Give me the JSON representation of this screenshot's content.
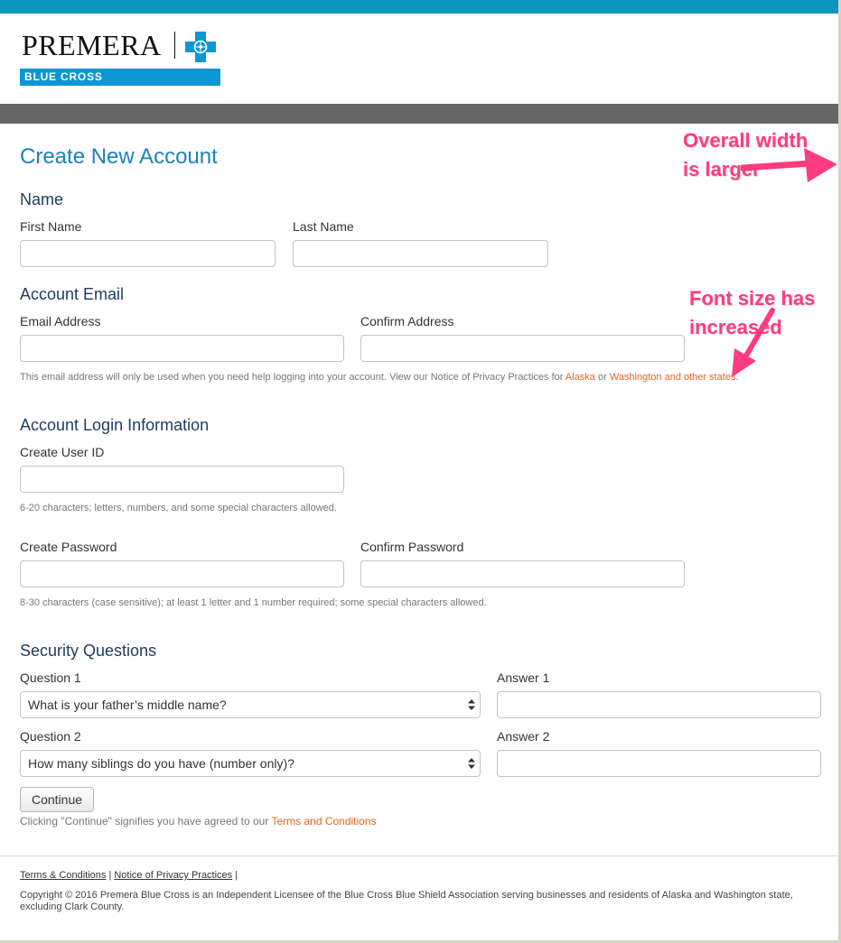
{
  "brand": {
    "wordmark": "PREMERA",
    "sub_label": "BLUE CROSS",
    "accent_color": "#0b96bd",
    "logo_blue": "#0b96d6"
  },
  "page": {
    "title": "Create New Account"
  },
  "name_section": {
    "title": "Name",
    "first_name_label": "First Name",
    "last_name_label": "Last Name",
    "first_name_value": "",
    "last_name_value": ""
  },
  "email_section": {
    "title": "Account Email",
    "email_label": "Email Address",
    "confirm_label": "Confirm Address",
    "email_value": "",
    "confirm_value": "",
    "help_text": "This email address will only be used when you need help logging into your account. View our Notice of Privacy Practices for",
    "link_alaska": "Alaska",
    "or_text": "or",
    "link_washington": "Washington and other states",
    "period": "."
  },
  "login_section": {
    "title": "Account Login Information",
    "user_id_label": "Create User ID",
    "user_id_value": "",
    "user_id_help": "6-20 characters; letters, numbers, and some special characters allowed.",
    "password_label": "Create Password",
    "confirm_password_label": "Confirm Password",
    "password_help": "8-30 characters (case sensitive); at least 1 letter and 1 number required; some special characters allowed."
  },
  "security_section": {
    "title": "Security Questions",
    "question1_label": "Question 1",
    "question1_value": "What is your father’s middle name?",
    "answer1_label": "Answer 1",
    "question2_label": "Question 2",
    "question2_value": "How many siblings do you have (number only)?",
    "answer2_label": "Answer 2"
  },
  "actions": {
    "continue_label": "Continue",
    "agree_text": "Clicking \"Continue\" signifies you have agreed to our",
    "terms_link": "Terms and Conditions"
  },
  "footer": {
    "terms_link": "Terms & Conditions",
    "privacy_link": "Notice of Privacy Practices",
    "separator": "|",
    "copyright": "Copyright © 2016 Premera Blue Cross is an Independent Licensee of the Blue Cross Blue Shield Association serving businesses and residents of Alaska and Washington state, excluding Clark County."
  },
  "annotations": {
    "width_note_line1": "Overall width",
    "width_note_line2": "is larger",
    "font_note_line1": "Font size has",
    "font_note_line2": "increased",
    "color": "#ff3c7e"
  }
}
